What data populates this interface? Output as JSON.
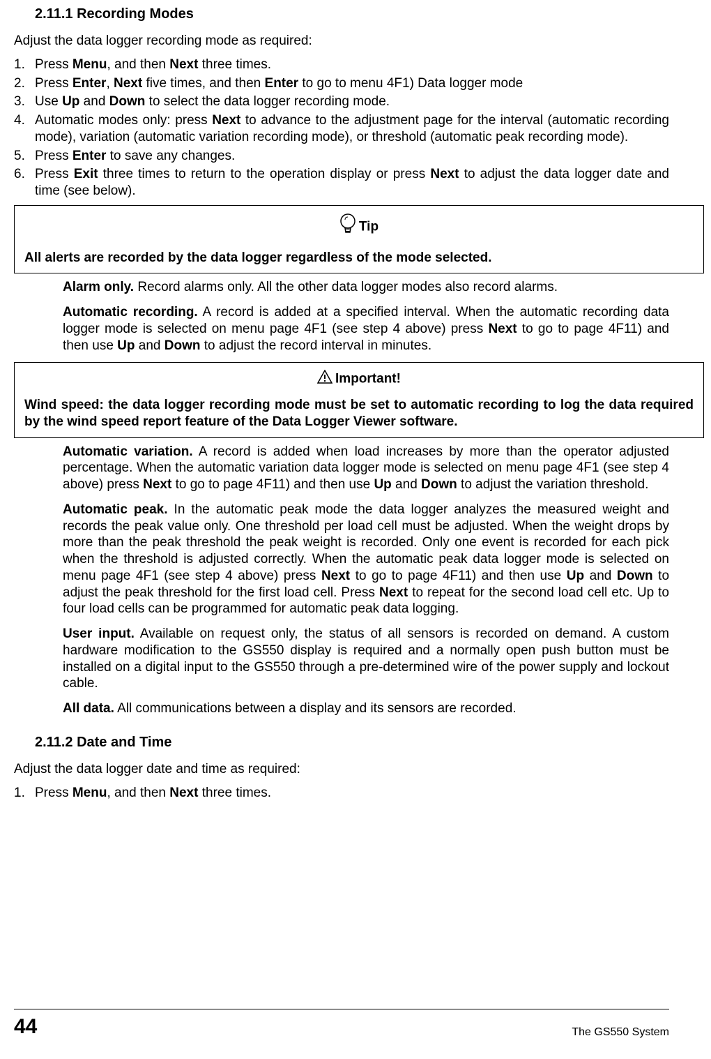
{
  "section1": {
    "number": "2.11.1",
    "title": "Recording Modes",
    "intro": "Adjust the data logger recording mode as required:"
  },
  "steps1": [
    {
      "n": "1.",
      "pre": "Press ",
      "b1": "Menu",
      "mid": ", and then ",
      "b2": "Next",
      "post": " three times."
    },
    {
      "n": "2.",
      "pre": "Press ",
      "b1": "Enter",
      "mid1": ", ",
      "b2": "Next",
      "mid2": " five times, and then ",
      "b3": "Enter",
      "post": " to go to menu 4F1) Data logger mode"
    },
    {
      "n": "3.",
      "pre": "Use ",
      "b1": "Up",
      "mid": " and ",
      "b2": "Down",
      "post": " to select the data logger recording mode."
    },
    {
      "n": "4.",
      "pre": "Automatic modes only: press ",
      "b1": "Next",
      "post": " to advance to the adjustment page for the interval (automatic recording mode), variation (automatic variation recording mode), or threshold (automatic peak recording mode)."
    },
    {
      "n": "5.",
      "pre": "Press ",
      "b1": "Enter",
      "post": " to save any changes."
    },
    {
      "n": "6.",
      "pre": "Press ",
      "b1": "Exit",
      "mid": " three times to return to the operation display or press ",
      "b2": "Next",
      "post": " to adjust the data logger date and time (see below)."
    }
  ],
  "tip": {
    "label": "Tip",
    "body": "All alerts are recorded by the data logger regardless of the mode selected."
  },
  "modes": {
    "alarm": {
      "title": "Alarm only.",
      "body": " Record alarms only. All the other data logger modes also record alarms."
    },
    "auto": {
      "title": "Automatic recording.",
      "t1": " A record is added at a specified interval. When the automatic recording data logger mode is selected on menu page 4F1 (see step 4 above) press ",
      "b1": "Next",
      "t2": " to go to page 4F11) and then use ",
      "b2": "Up",
      "t3": " and ",
      "b3": "Down",
      "t4": " to adjust the record interval in minutes."
    },
    "variation": {
      "title": "Automatic variation.",
      "t1": " A record is added when load increases by more than the operator adjusted percentage. When the automatic variation data logger mode is selected on menu page 4F1 (see step 4 above) press ",
      "b1": "Next",
      "t2": " to go to page 4F11) and then use ",
      "b2": "Up",
      "t3": " and ",
      "b3": "Down",
      "t4": " to adjust the variation threshold."
    },
    "peak": {
      "title": "Automatic peak.",
      "t1": " In the automatic peak mode the data logger analyzes the measured weight and records the peak value only. One threshold per load cell must be adjusted. When the weight drops by more than the peak threshold the peak weight is recorded. Only one event is recorded for each pick when the threshold is adjusted correctly. When the automatic peak data logger mode is selected on menu page 4F1 (see step 4 above) press ",
      "b1": "Next",
      "t2": " to go to page 4F11) and then use ",
      "b2": "Up",
      "t3": " and ",
      "b3": "Down",
      "t4": " to adjust the peak threshold for the first load cell. Press ",
      "b4": "Next",
      "t5": " to repeat for the second load cell etc. Up to four load cells can be programmed for automatic peak data logging."
    },
    "user": {
      "title": "User input.",
      "body": " Available on request only, the status of all sensors is recorded on demand. A custom hardware modification to the GS550 display is required and a normally open push button must be installed on a digital input to the GS550 through a pre-determined wire of the power supply and lockout cable."
    },
    "all": {
      "title": "All data.",
      "body": " All communications between a display and its sensors are recorded."
    }
  },
  "important": {
    "label": "Important!",
    "body": "Wind speed: the data logger recording mode must be set to automatic recording to log the data required by the wind speed report feature of the Data Logger Viewer software."
  },
  "section2": {
    "number": "2.11.2",
    "title": "Date and Time",
    "intro": "Adjust the data logger date and time as required:"
  },
  "steps2": [
    {
      "n": "1.",
      "pre": "Press ",
      "b1": "Menu",
      "mid": ", and then ",
      "b2": "Next",
      "post": " three times."
    }
  ],
  "footer": {
    "page": "44",
    "doc": "The GS550 System"
  }
}
